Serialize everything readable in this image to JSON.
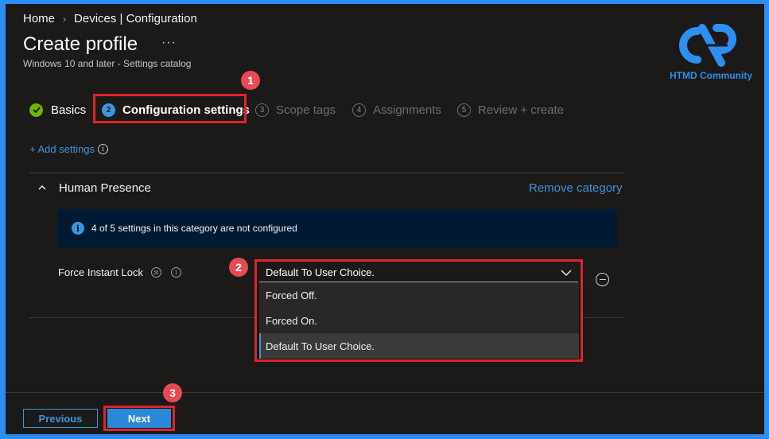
{
  "breadcrumb": {
    "home": "Home",
    "separator": "›",
    "current": "Devices | Configuration"
  },
  "header": {
    "title": "Create profile",
    "more": "···",
    "subtitle": "Windows 10 and later - Settings catalog"
  },
  "logo": {
    "text": "HTMD Community",
    "color": "#2e8ff0"
  },
  "steps": [
    {
      "label": "Basics",
      "state": "completed"
    },
    {
      "number": "2",
      "label": "Configuration settings",
      "state": "active"
    },
    {
      "number": "3",
      "label": "Scope tags",
      "state": "disabled"
    },
    {
      "number": "4",
      "label": "Assignments",
      "state": "disabled"
    },
    {
      "number": "5",
      "label": "Review + create",
      "state": "disabled"
    }
  ],
  "add_settings": {
    "label": "+ Add settings",
    "info": "i"
  },
  "category": {
    "title": "Human Presence",
    "remove_label": "Remove category",
    "info_message": "4 of 5 settings in this category are not configured",
    "info_icon": "i"
  },
  "setting": {
    "label": "Force Instant Lock",
    "selected": "Default To User Choice.",
    "options": [
      "Forced Off.",
      "Forced On.",
      "Default To User Choice."
    ]
  },
  "annotations": [
    "1",
    "2",
    "3"
  ],
  "footer": {
    "previous": "Previous",
    "next": "Next"
  },
  "colors": {
    "accent": "#3a96dd",
    "highlight": "#e0242b",
    "badge": "#e84a52",
    "frame": "#2a8ff0",
    "background": "#1b1a19"
  }
}
